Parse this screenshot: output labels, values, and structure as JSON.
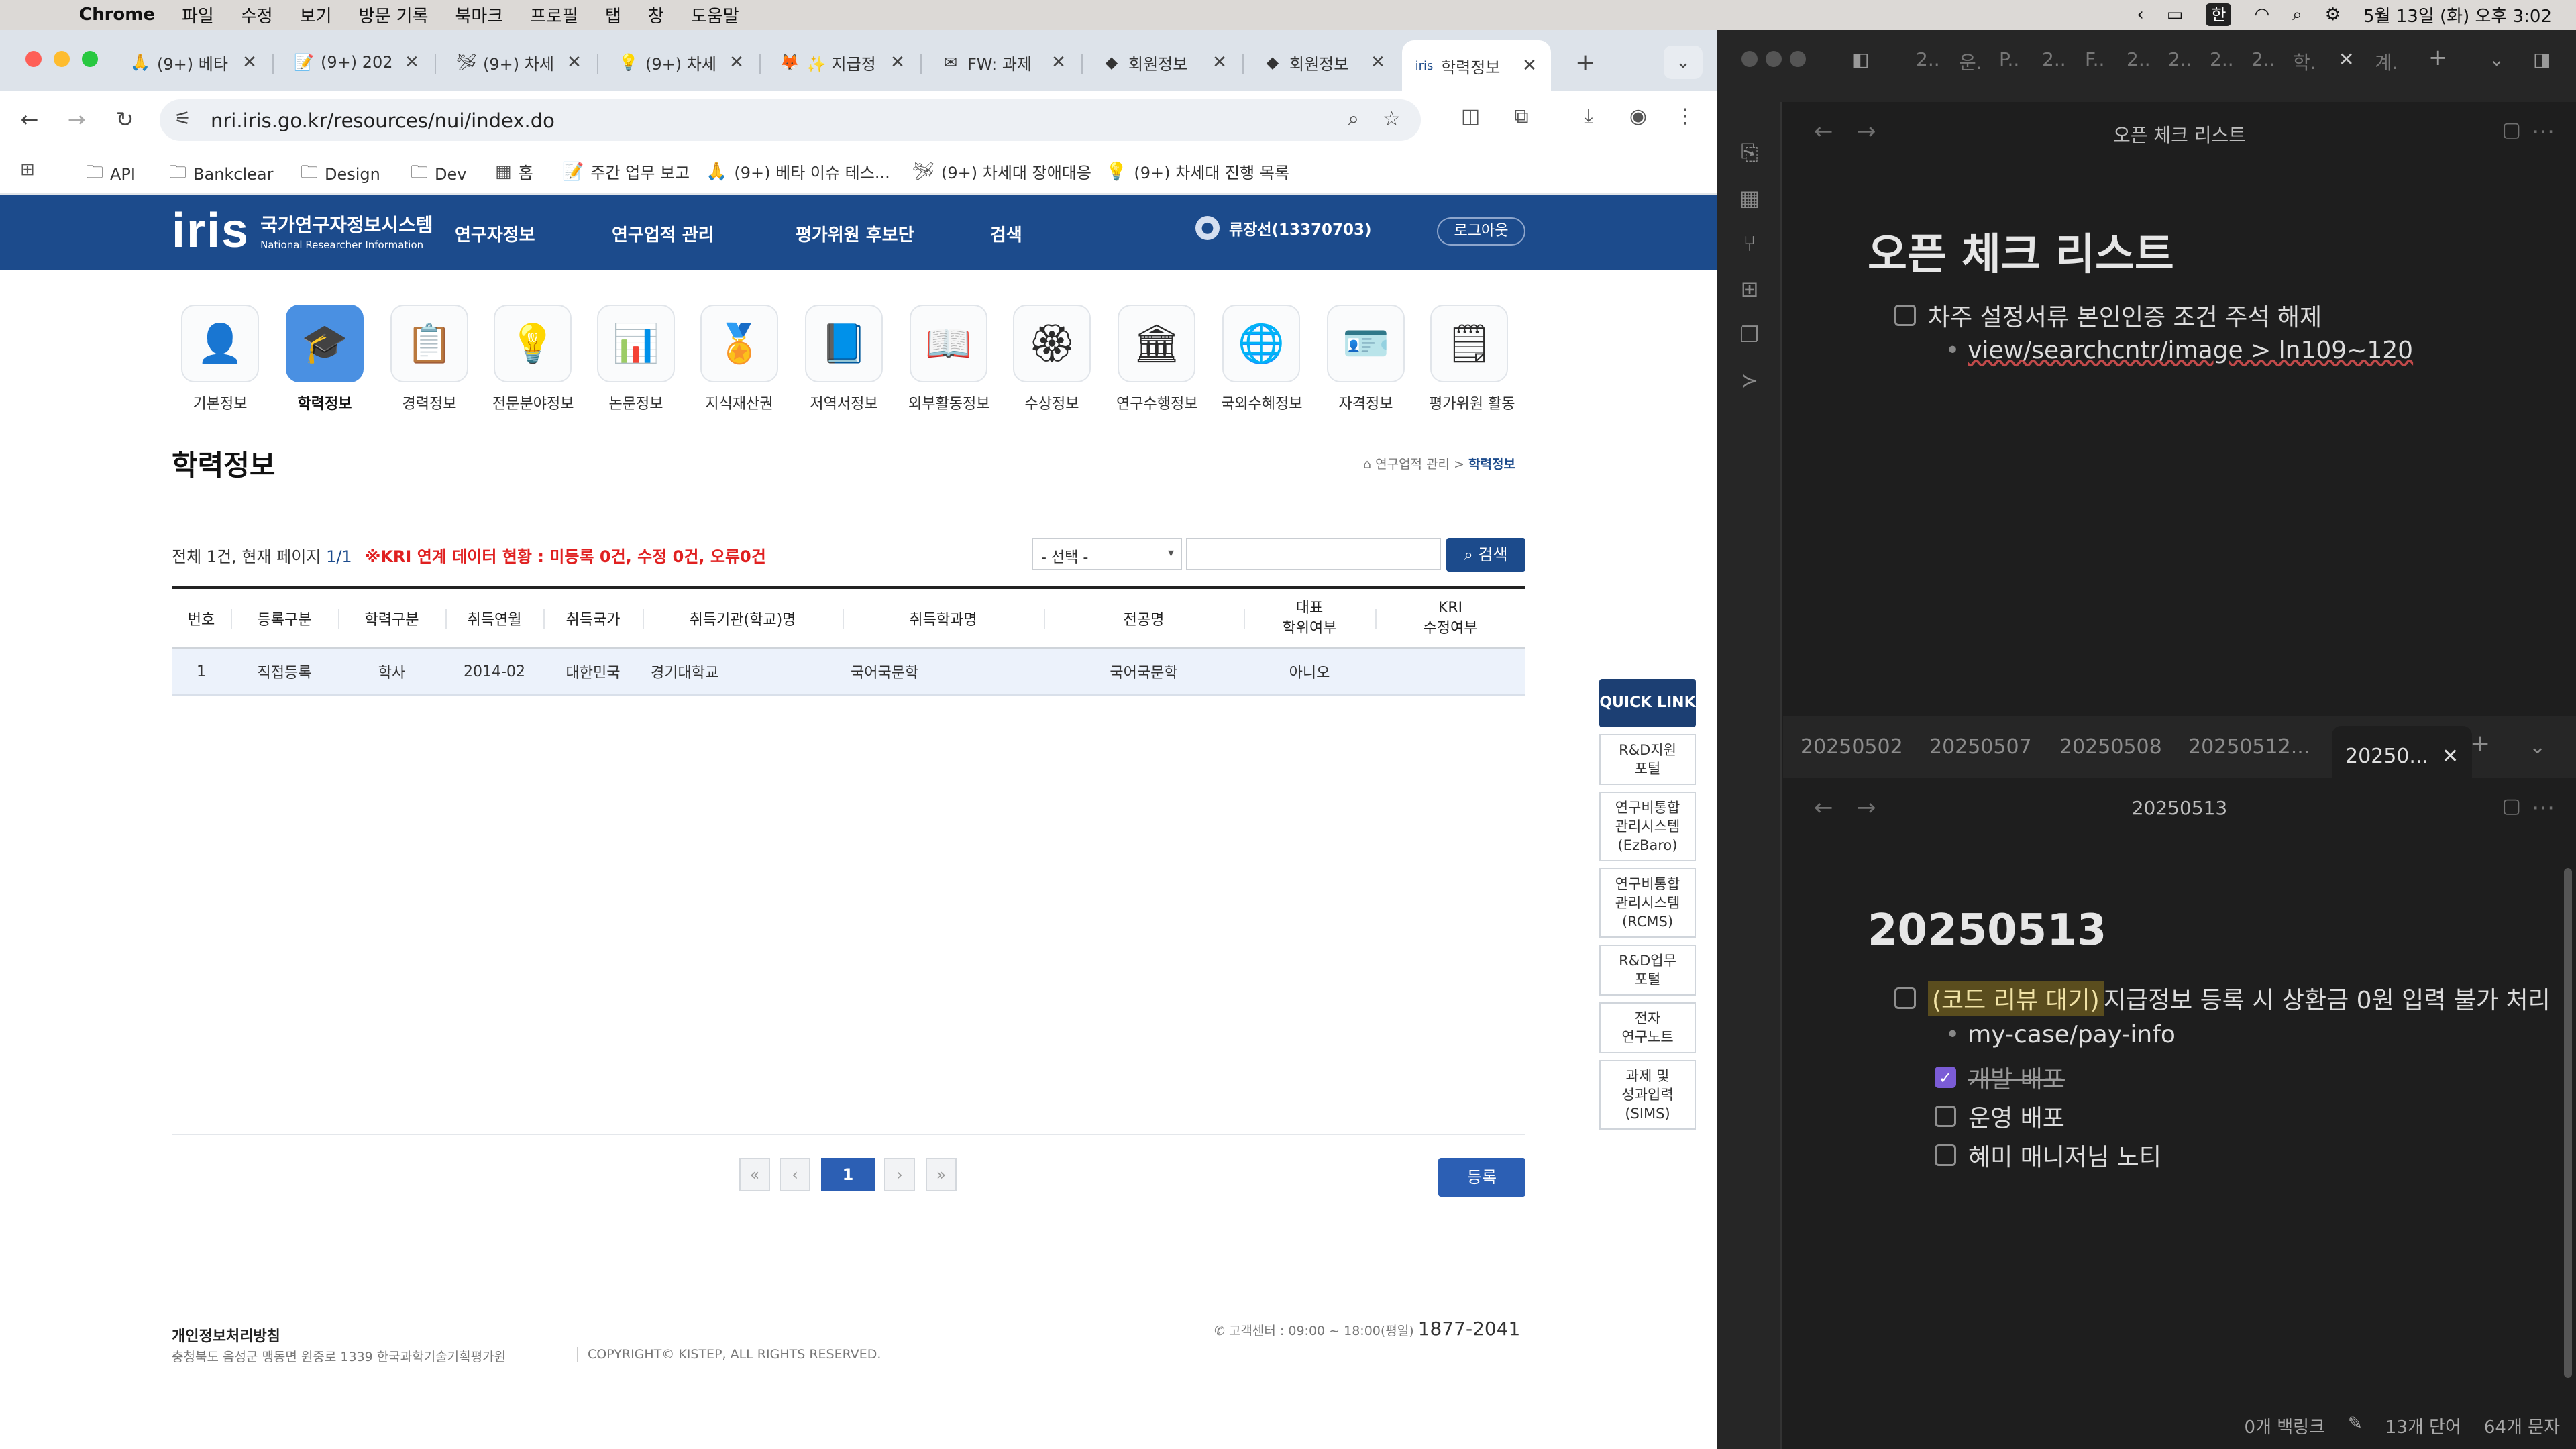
{
  "menubar": {
    "app": "Chrome",
    "items": [
      "파일",
      "수정",
      "보기",
      "방문 기록",
      "북마크",
      "프로필",
      "탭",
      "창",
      "도움말"
    ],
    "ime": "한",
    "datetime": "5월 13일 (화) 오후 3:02"
  },
  "browser": {
    "tabs": [
      {
        "label": "(9+) 베타",
        "icon": "🙏"
      },
      {
        "label": "(9+) 202",
        "icon": "📝"
      },
      {
        "label": "(9+) 차세",
        "icon": "🛩"
      },
      {
        "label": "(9+) 차세",
        "icon": "💡"
      },
      {
        "label": "✨ 지급정",
        "icon": "🦊"
      },
      {
        "label": "FW: 과제",
        "icon": "✉"
      },
      {
        "label": "회원정보",
        "icon": "◆"
      },
      {
        "label": "회원정보",
        "icon": "◆"
      },
      {
        "label": "학력정보",
        "icon": "iris"
      }
    ],
    "url": "nri.iris.go.kr/resources/nui/index.do",
    "bookmarks": [
      {
        "label": "API",
        "icon": "folder-icon"
      },
      {
        "label": "Bankclear",
        "icon": "folder-icon"
      },
      {
        "label": "Design",
        "icon": "folder-icon"
      },
      {
        "label": "Dev",
        "icon": "folder-icon"
      },
      {
        "label": "홈",
        "icon": "notion-icon"
      },
      {
        "label": "주간 업무 보고",
        "icon": "note-icon"
      },
      {
        "label": "(9+) 베타 이슈 테스...",
        "icon": "pray-icon"
      },
      {
        "label": "(9+) 차세대 장애대응",
        "icon": "plane-icon"
      },
      {
        "label": "(9+) 차세대 진행 목록",
        "icon": "bulb-icon"
      }
    ]
  },
  "site": {
    "logo_mark": "iris",
    "logo_ko": "국가연구자정보시스템",
    "logo_en": "National Researcher Information",
    "nav": [
      "연구자정보",
      "연구업적 관리",
      "평가위원 후보단",
      "검색"
    ],
    "user": "류장선(13370703)",
    "logout": "로그아웃",
    "categories": [
      {
        "label": "기본정보",
        "icon": "👤"
      },
      {
        "label": "학력정보",
        "icon": "🎓"
      },
      {
        "label": "경력정보",
        "icon": "📋"
      },
      {
        "label": "전문분야정보",
        "icon": "💡"
      },
      {
        "label": "논문정보",
        "icon": "📊"
      },
      {
        "label": "지식재산권",
        "icon": "🏅"
      },
      {
        "label": "저역서정보",
        "icon": "📘"
      },
      {
        "label": "외부활동정보",
        "icon": "📖"
      },
      {
        "label": "수상정보",
        "icon": "🏵"
      },
      {
        "label": "연구수행정보",
        "icon": "🏛"
      },
      {
        "label": "국외수혜정보",
        "icon": "🌐"
      },
      {
        "label": "자격정보",
        "icon": "🪪"
      },
      {
        "label": "평가위원 활동",
        "icon": "🗒"
      }
    ],
    "page_title": "학력정보",
    "breadcrumb_parent": "연구업적 관리",
    "breadcrumb_current": "학력정보",
    "count_prefix": "전체 1건, 현재 페이지 ",
    "count_page": "1/1",
    "kri_notice": "※KRI 연계 데이터 현황 : 미등록 0건, 수정 0건, 오류0건",
    "select_value": "- 선택 -",
    "search_value": "",
    "search_button": "검색",
    "table": {
      "headers": [
        "번호",
        "등록구분",
        "학력구분",
        "취득연월",
        "취득국가",
        "취득기관(학교)명",
        "취득학과명",
        "전공명",
        "대표\n학위여부",
        "KRI\n수정여부"
      ],
      "rows": [
        [
          "1",
          "직접등록",
          "학사",
          "2014-02",
          "대한민국",
          "경기대학교",
          "국어국문학",
          "국어국문학",
          "아니오",
          ""
        ]
      ]
    },
    "pagination": {
      "first": "«",
      "prev": "‹",
      "current": "1",
      "next": "›",
      "last": "»"
    },
    "register_button": "등록",
    "quick_link": {
      "title": "QUICK LINK",
      "links": [
        "R&D지원\n포털",
        "연구비통합\n관리시스템\n(EzBaro)",
        "연구비통합\n관리시스템\n(RCMS)",
        "R&D업무\n포털",
        "전자\n연구노트",
        "과제 및\n성과입력\n(SIMS)"
      ]
    },
    "footer": {
      "privacy": "개인정보처리방침",
      "address": "충청북도 음성군 맹동면 원중로 1339 한국과학기술기획평가원",
      "copyright": "COPYRIGHT© KISTEP, ALL RIGHTS RESERVED.",
      "call_label": "고객센터 : 09:00 ~ 18:00(평일)",
      "call_number": "1877-2041"
    }
  },
  "obsidian": {
    "top_tabs": [
      "2..",
      "운.",
      "P..",
      "2..",
      "F..",
      "2..",
      "2..",
      "2..",
      "2..",
      "학.",
      "계."
    ],
    "note1": {
      "title_bar": "오픈 체크 리스트",
      "heading": "오픈 체크 리스트",
      "todo": "차주 설정서류 본인인증 조건 주석 해제",
      "bullet": "view/searchcntr/image > ln109~120"
    },
    "doc_tabs": [
      "20250502",
      "20250507",
      "20250508",
      "20250512...",
      "20250..."
    ],
    "note2": {
      "title_bar": "20250513",
      "heading": "20250513",
      "todo_highlight": "(코드 리뷰 대기)",
      "todo_text": " 지급정보 등록 시 상환금 0원 입력 불가 처리",
      "bullet": "my-case/pay-info",
      "subtasks": [
        {
          "label": "개발 배포",
          "done": true
        },
        {
          "label": "운영 배포",
          "done": false
        },
        {
          "label": "혜미 매니저님 노티",
          "done": false
        }
      ]
    },
    "status": {
      "backlinks": "0개 백링크",
      "words": "13개 단어",
      "chars": "64개 문자"
    }
  }
}
